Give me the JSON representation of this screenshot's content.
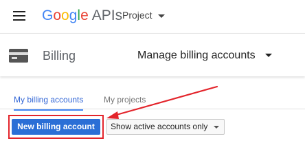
{
  "header": {
    "menu_icon": "hamburger-menu-icon",
    "logo": {
      "letters": [
        "G",
        "o",
        "o",
        "g",
        "l",
        "e"
      ],
      "product": "APIs"
    },
    "project_selector": {
      "label": "Project"
    }
  },
  "section": {
    "icon": "credit-card-icon",
    "title": "Billing",
    "manage_dropdown": {
      "label": "Manage billing accounts"
    }
  },
  "tabs": [
    {
      "label": "My billing accounts",
      "active": true
    },
    {
      "label": "My projects",
      "active": false
    }
  ],
  "actions": {
    "new_account_button": "New billing account",
    "filter_select": {
      "selected": "Show active accounts only"
    }
  },
  "colors": {
    "brand_blue": "#4285f4",
    "primary_button": "#2b6fd6",
    "annotation_red": "#e3242b",
    "active_tab": "#3367d6"
  }
}
